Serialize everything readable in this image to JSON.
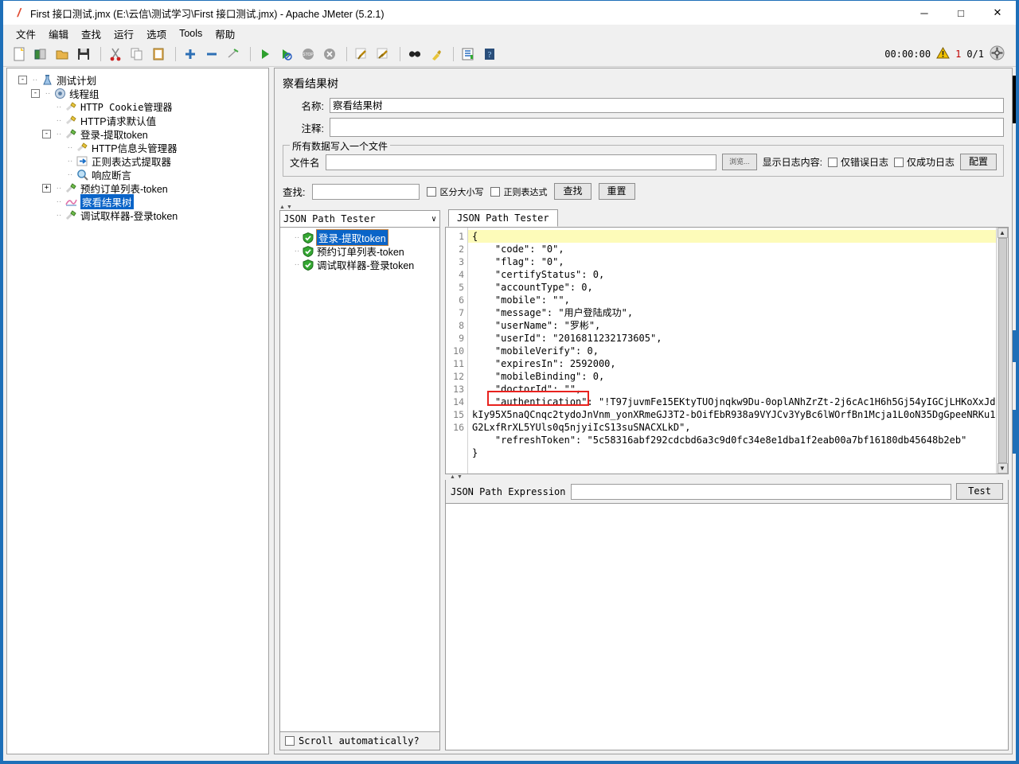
{
  "window": {
    "title": "First 接口测试.jmx (E:\\云信\\测试学习\\First 接口测试.jmx) - Apache JMeter (5.2.1)",
    "app_icon": "jmeter-feather-icon",
    "minimize": "─",
    "maximize": "□",
    "close": "✕"
  },
  "menu": [
    {
      "label": "文件",
      "name": "menu-file"
    },
    {
      "label": "编辑",
      "name": "menu-edit"
    },
    {
      "label": "查找",
      "name": "menu-search"
    },
    {
      "label": "运行",
      "name": "menu-run"
    },
    {
      "label": "选项",
      "name": "menu-options"
    },
    {
      "label": "Tools",
      "name": "menu-tools"
    },
    {
      "label": "帮助",
      "name": "menu-help"
    }
  ],
  "toolbar": {
    "icons": [
      "new-document-icon",
      "templates-icon",
      "open-folder-icon",
      "save-icon",
      "cut-icon",
      "copy-icon",
      "paste-icon",
      "expand-all-icon",
      "collapse-all-icon",
      "toggle-icon",
      "start-icon",
      "start-no-pauses-icon",
      "stop-icon",
      "shutdown-icon",
      "clear-icon",
      "clear-all-icon",
      "search-icon",
      "search-reset-icon",
      "function-helper-icon",
      "help-icon"
    ],
    "timer": "00:00:00",
    "warning_icon": "warning-triangle-icon",
    "warning_count": "1",
    "thread_count": "0/1",
    "refresh_icon": "navigate-icon"
  },
  "tree": {
    "items": [
      {
        "label": "测试计划",
        "indent": 0,
        "toggle": "-",
        "icon": "test-plan-icon",
        "selected": false,
        "mono": false
      },
      {
        "label": "线程组",
        "indent": 1,
        "toggle": "-",
        "icon": "thread-group-icon",
        "selected": false,
        "mono": false
      },
      {
        "label": "HTTP Cookie管理器",
        "indent": 2,
        "toggle": "",
        "icon": "config-element-icon",
        "selected": false,
        "mono": true
      },
      {
        "label": "HTTP请求默认值",
        "indent": 2,
        "toggle": "",
        "icon": "config-element-icon",
        "selected": false,
        "mono": false
      },
      {
        "label": "登录-提取token",
        "indent": 2,
        "toggle": "-",
        "icon": "sampler-icon",
        "selected": false,
        "mono": false
      },
      {
        "label": "HTTP信息头管理器",
        "indent": 3,
        "toggle": "",
        "icon": "config-element-icon",
        "selected": false,
        "mono": false
      },
      {
        "label": "正则表达式提取器",
        "indent": 3,
        "toggle": "",
        "icon": "post-processor-icon",
        "selected": false,
        "mono": false
      },
      {
        "label": "响应断言",
        "indent": 3,
        "toggle": "",
        "icon": "assertion-icon",
        "selected": false,
        "mono": false
      },
      {
        "label": "预约订单列表-token",
        "indent": 2,
        "toggle": "+",
        "icon": "sampler-icon",
        "selected": false,
        "mono": false
      },
      {
        "label": "察看结果树",
        "indent": 2,
        "toggle": "",
        "icon": "view-results-tree-icon",
        "selected": true,
        "mono": false
      },
      {
        "label": "调试取样器-登录token",
        "indent": 2,
        "toggle": "",
        "icon": "sampler-icon",
        "selected": false,
        "mono": false
      }
    ]
  },
  "main": {
    "title": "察看结果树",
    "name_label": "名称:",
    "name_value": "察看结果树",
    "comment_label": "注释:",
    "comment_value": "",
    "file_group_legend": "所有数据写入一个文件",
    "filename_label": "文件名",
    "filename_value": "",
    "browse_button": "浏览...",
    "log_display_label": "显示日志内容:",
    "errors_only_label": "仅错误日志",
    "success_only_label": "仅成功日志",
    "errors_only_checked": false,
    "success_only_checked": false,
    "configure_button": "配置",
    "search_label": "查找:",
    "search_value": "",
    "case_sensitive_label": "区分大小写",
    "case_sensitive_checked": false,
    "regex_label": "正则表达式",
    "regex_checked": false,
    "search_button": "查找",
    "reset_button": "重置"
  },
  "results": {
    "renderer_selected": "JSON Path Tester",
    "dropdown_icon": "chevron-down-icon",
    "samples": [
      {
        "label": "登录-提取token",
        "status": "success",
        "selected": true
      },
      {
        "label": "预约订单列表-token",
        "status": "success",
        "selected": false
      },
      {
        "label": "调试取样器-登录token",
        "status": "success",
        "selected": false
      }
    ],
    "scroll_auto_label": "Scroll automatically?",
    "scroll_auto_checked": false,
    "tab_label": "JSON Path Tester",
    "expression_label": "JSON Path Expression",
    "expression_value": "",
    "test_button": "Test",
    "highlight_color": "#e8221e",
    "highlighted_key": "\"authentication\":"
  },
  "code": {
    "line_numbers": [
      "1",
      "2",
      "3",
      "4",
      "5",
      "6",
      "7",
      "8",
      "9",
      "10",
      "11",
      "12",
      "13",
      "14",
      "15",
      "16"
    ],
    "lines": [
      "{",
      "    \"code\": \"0\",",
      "    \"flag\": \"0\",",
      "    \"certifyStatus\": 0,",
      "    \"accountType\": 0,",
      "    \"mobile\": \"\",",
      "    \"message\": \"用户登陆成功\",",
      "    \"userName\": \"罗彬\",",
      "    \"userId\": \"2016811232173605\",",
      "    \"mobileVerify\": 0,",
      "    \"expiresIn\": 2592000,",
      "    \"mobileBinding\": 0,",
      "    \"doctorId\": \"\",",
      "    \"authentication\": \"!T97juvmFe15EKtyTUOjnqkw9Du-0oplANhZrZt-2j6cAc1H6h5Gj54yIGCjLHKoXxJdkIy95X5naQCnqc2tydoJnVnm_yonXRmeGJ3T2-bOifEbR938a9VYJCv3YyBc6lWOrfBn1Mcja1L0oN35DgGpeeNRKu1G2LxfRrXL5YUls0q5njyiIcS13suSNACXLkD\",",
      "    \"refreshToken\": \"5c58316abf292cdcbd6a3c9d0fc34e8e1dba1f2eab00a7bf16180db45648b2eb\"",
      "}"
    ],
    "highlighted_line": 1
  }
}
